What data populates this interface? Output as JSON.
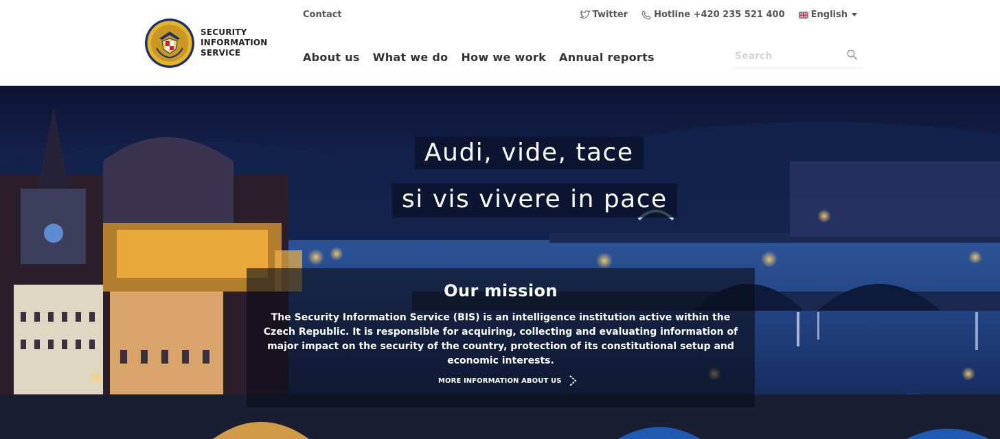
{
  "header": {
    "logo_lines": [
      "SECURITY",
      "INFORMATION",
      "SERVICE"
    ],
    "contact_label": "Contact",
    "twitter_label": "Twitter",
    "hotline_label": "Hotline +420 235 521 400",
    "language_label": "English",
    "nav": [
      "About us",
      "What we do",
      "How we work",
      "Annual reports"
    ],
    "search_placeholder": "Search",
    "icons": {
      "twitter": "twitter-icon",
      "phone": "phone-icon",
      "flag": "uk-flag-icon",
      "search": "search-icon"
    }
  },
  "hero": {
    "motto_line_1": "Audi, vide, tace",
    "motto_line_2": "si vis vivere in pace",
    "mission_title": "Our mission",
    "mission_text": "The Security Information Service (BIS) is an intelligence institution active within the Czech Republic. It is responsible for acquiring, collecting and evaluating information of major impact on the security of the country, protection of its constitutional setup and economic interests.",
    "more_link_label": "MORE INFORMATION ABOUT US"
  },
  "colors": {
    "nav_text": "#333333",
    "hero_dark": "#0b1432",
    "hero_blue": "#24407a",
    "seal_gold": "#e2b52a",
    "seal_navy": "#1d2f6e"
  }
}
